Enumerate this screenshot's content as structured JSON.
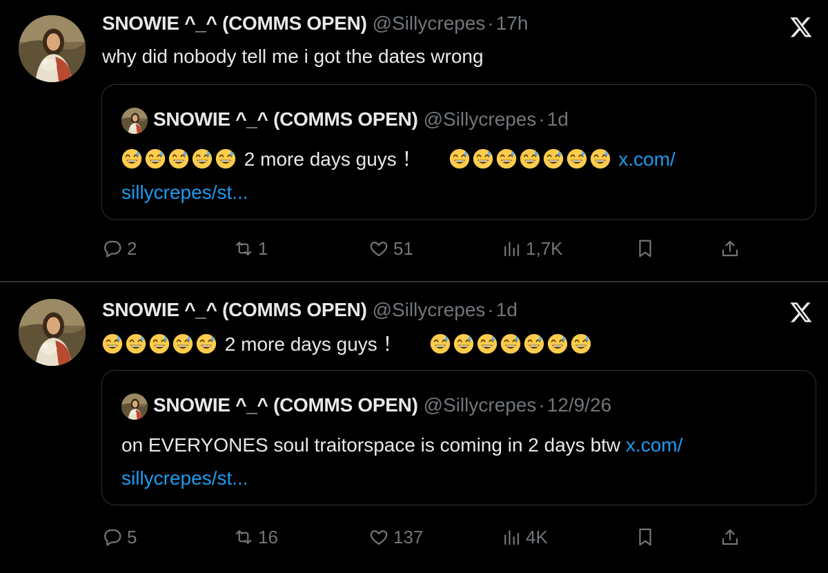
{
  "tweets": [
    {
      "name": "SNOWIE ^_^ (COMMS OPEN)",
      "handle": "@Sillycrepes",
      "separator": "·",
      "time": "17h",
      "text": "why did nobody tell me i got the dates wrong",
      "quote": {
        "name": "SNOWIE ^_^ (COMMS OPEN)",
        "handle": "@Sillycrepes",
        "separator": "·",
        "time": "1d",
        "text": "2 more days guys ！",
        "link": "x.com/",
        "link_cont": "sillycrepes/st..."
      },
      "actions": {
        "replies": "2",
        "reposts": "1",
        "likes": "51",
        "views": "1,7K"
      }
    },
    {
      "name": "SNOWIE ^_^ (COMMS OPEN)",
      "handle": "@Sillycrepes",
      "separator": "·",
      "time": "1d",
      "text": "2 more days guys ！",
      "quote": {
        "name": "SNOWIE ^_^ (COMMS OPEN)",
        "handle": "@Sillycrepes",
        "separator": "·",
        "time": "12/9/26",
        "text": "on EVERYONES soul traitorspace is coming in 2 days btw",
        "link": "x.com/",
        "link_cont": "sillycrepes/st..."
      },
      "actions": {
        "replies": "5",
        "reposts": "16",
        "likes": "137",
        "views": "4K"
      }
    }
  ],
  "colors": {
    "background": "#000000",
    "text": "#e7e9ea",
    "muted": "#71767b",
    "link": "#1d9bf0",
    "border": "#2f3336"
  },
  "icons": {
    "emoji": "grinning-face-with-sweat-emoji",
    "logo": "x-logo-icon"
  }
}
